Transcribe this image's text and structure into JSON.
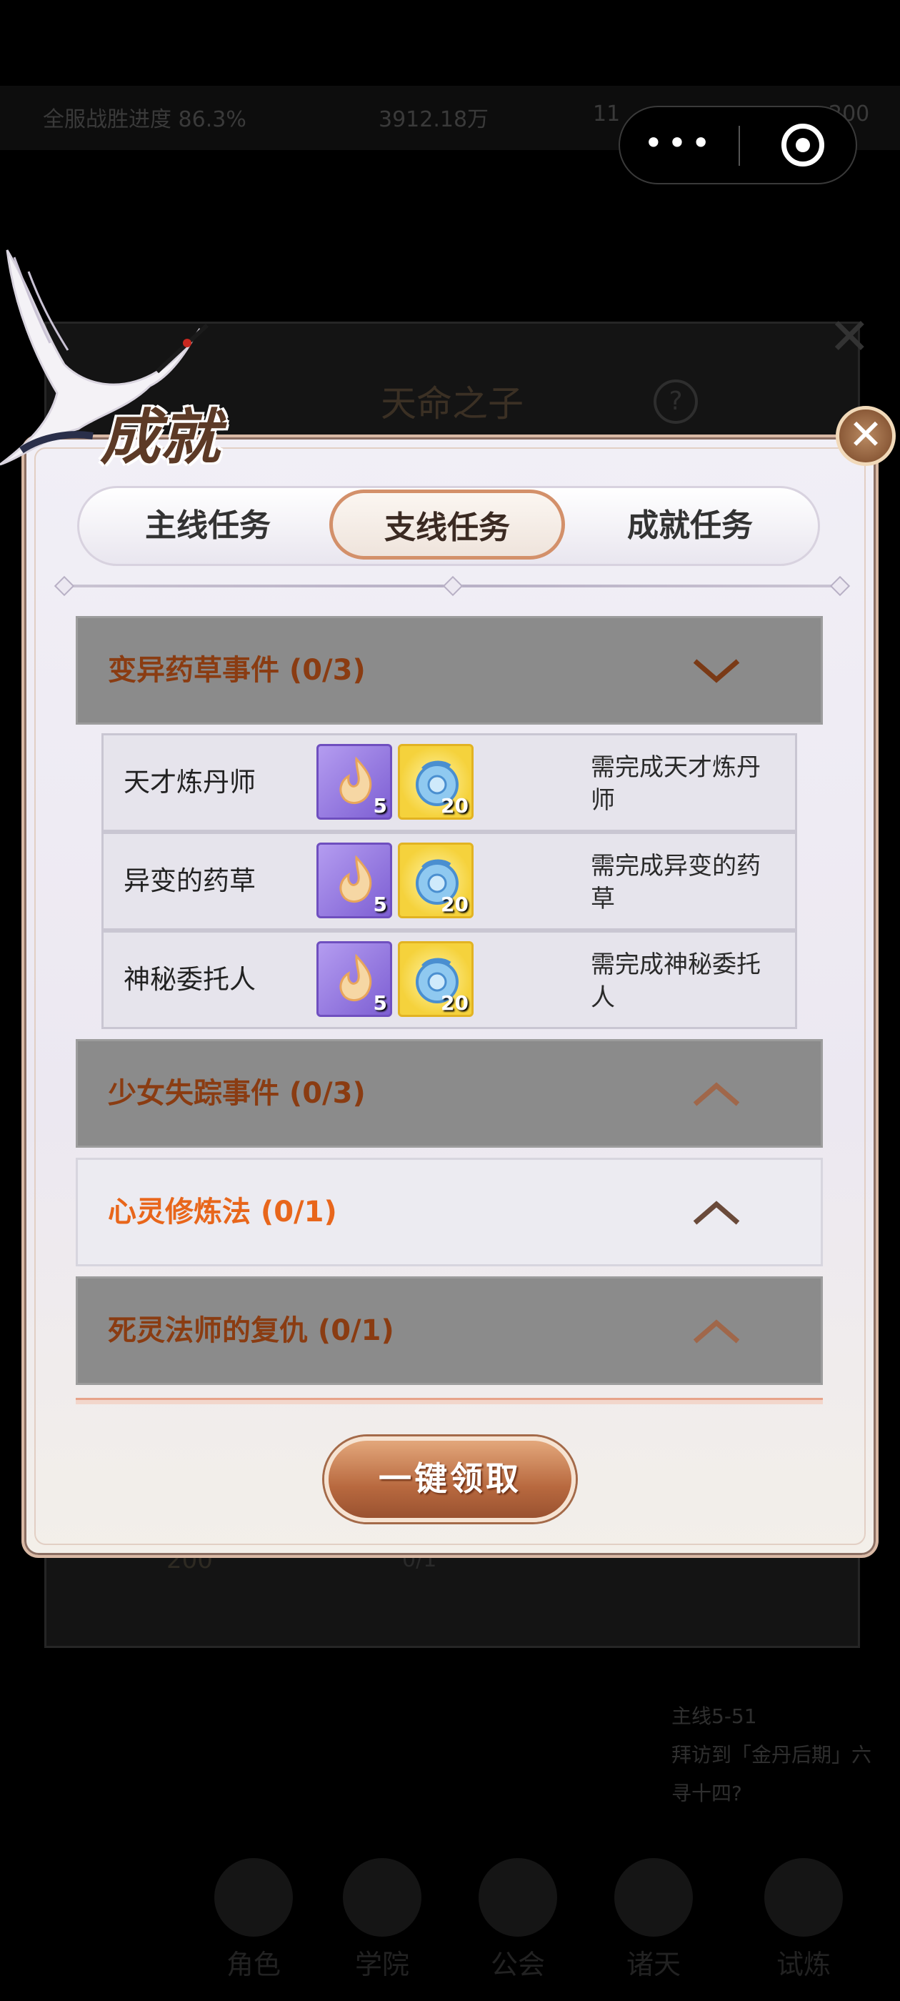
{
  "background": {
    "topbar": [
      "全服战胜进度 86.3%",
      "3912.18万",
      "11",
      "200"
    ],
    "dialog_title": "天命之子",
    "help": "?",
    "reward_value": "200",
    "progress_value": "0/1",
    "side": {
      "line1": "主线5-51",
      "line2": "拜访到「金丹后期」六",
      "line3": "寻十四?"
    },
    "nav": [
      "角色",
      "学院",
      "公会",
      "诸天",
      "试炼"
    ]
  },
  "panel": {
    "title": "成就",
    "close_icon": "close-icon",
    "tabs": [
      "主线任务",
      "支线任务",
      "成就任务"
    ],
    "active_tab": "支线任务",
    "categories": [
      {
        "name": "变异药草事件 (0/3)",
        "expanded": true,
        "tasks": [
          {
            "name": "天才炼丹师",
            "reward1_count": "5",
            "reward2_count": "20",
            "requirement": "需完成天才炼丹师"
          },
          {
            "name": "异变的药草",
            "reward1_count": "5",
            "reward2_count": "20",
            "requirement": "需完成异变的药草"
          },
          {
            "name": "神秘委托人",
            "reward1_count": "5",
            "reward2_count": "20",
            "requirement": "需完成神秘委托人"
          }
        ]
      },
      {
        "name": "少女失踪事件 (0/3)",
        "expanded": false
      },
      {
        "name": "心灵修炼法 (0/1)",
        "expanded": false
      },
      {
        "name": "死灵法师的复仇 (0/1)",
        "expanded": false
      }
    ],
    "claim_button": "一键领取"
  },
  "colors": {
    "accent": "#d3906a",
    "category_text": "#8a3c12",
    "highlight_text": "#e8661b"
  }
}
